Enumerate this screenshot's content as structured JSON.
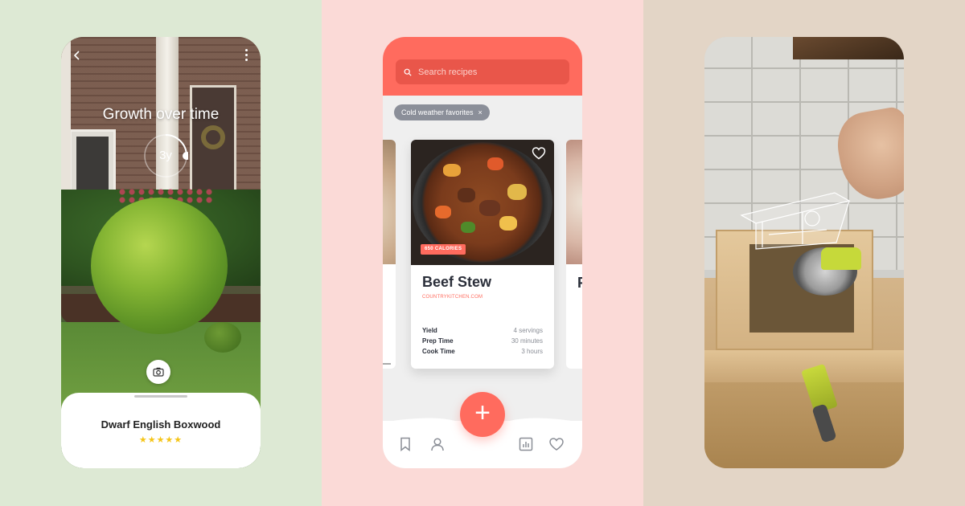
{
  "colors": {
    "left_bg": "#dde9d4",
    "middle_bg": "#fbdad7",
    "right_bg": "#e3d5c6",
    "recipe_accent": "#ff6b5e",
    "rating_star": "#f5c518"
  },
  "garden_app": {
    "back_icon": "back-chevron-icon",
    "menu_icon": "more-vertical-icon",
    "title": "Growth over time",
    "dial_value": "3y",
    "dial_progress": 0.25,
    "camera_icon": "camera-icon",
    "plant_name": "Dwarf English Boxwood",
    "rating": "★★★★★",
    "rating_value": 5
  },
  "recipe_app": {
    "search_icon": "search-icon",
    "search_placeholder": "Search recipes",
    "filter_chip": "Cold weather favorites",
    "filter_chip_close": "×",
    "featured": {
      "calories_badge": "650 CALORIES",
      "title": "Beef Stew",
      "source": "COUNTRYKITCHEN.COM",
      "heart_icon": "heart-outline-icon",
      "details": [
        {
          "label": "Yield",
          "value": "4 servings"
        },
        {
          "label": "Prep Time",
          "value": "30 minutes"
        },
        {
          "label": "Cook Time",
          "value": "3 hours"
        }
      ]
    },
    "next_card_initial": "F",
    "fab_label": "+",
    "nav_icons": [
      "bookmark-icon",
      "profile-icon",
      "chart-icon",
      "heart-icon"
    ]
  },
  "ar_app": {
    "model_name": "birdhouse-wireframe"
  }
}
